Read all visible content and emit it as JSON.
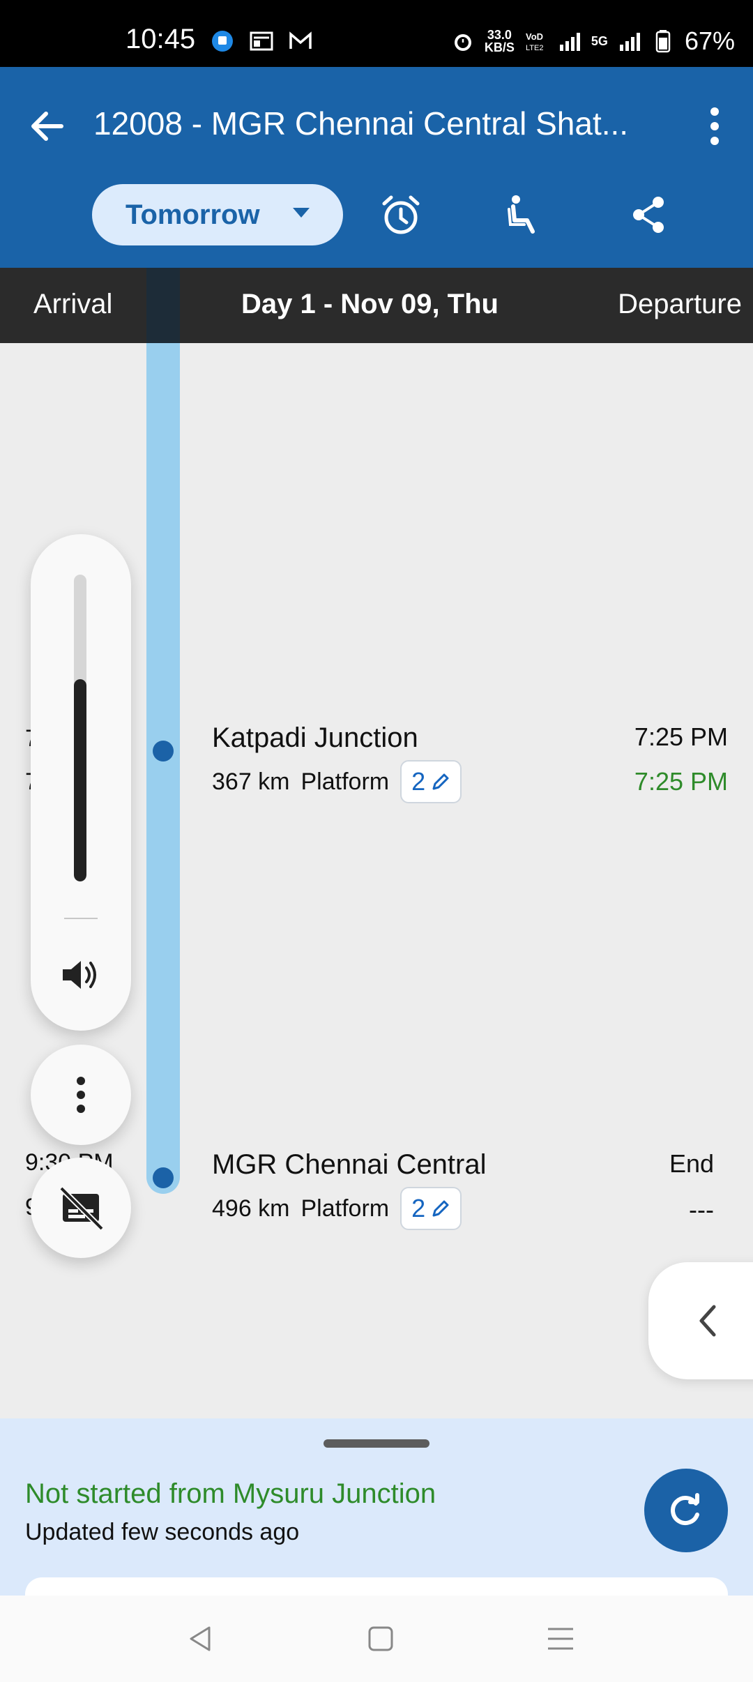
{
  "status_bar": {
    "time": "10:45",
    "speed_value": "33.0",
    "speed_unit": "KB/S",
    "network": "5G",
    "battery": "67%"
  },
  "app_bar": {
    "title": "12008 - MGR Chennai Central Shat...",
    "date_selector": "Tomorrow",
    "accent_color": "#1a63a8"
  },
  "day_header": {
    "arrival_label": "Arrival",
    "day_label": "Day 1 - Nov 09, Thu",
    "departure_label": "Departure"
  },
  "stops": [
    {
      "name": "Katpadi Junction",
      "distance": "367 km",
      "platform_label": "Platform",
      "platform": "2",
      "arrival_partial": "7",
      "arrival_actual_partial": "7",
      "departure_scheduled": "7:25 PM",
      "departure_actual": "7:25 PM"
    },
    {
      "name": "MGR Chennai Central",
      "distance": "496 km",
      "platform_label": "Platform",
      "platform": "2",
      "arrival_partial": "9:30 PM",
      "arrival_actual_partial": "9",
      "departure_scheduled": "End",
      "departure_actual": "---"
    }
  ],
  "volume": {
    "level": 0.66
  },
  "status_sheet": {
    "title": "Not started from Mysuru Junction",
    "subtitle": "Updated few seconds ago",
    "title_color": "#2e8b2a"
  }
}
